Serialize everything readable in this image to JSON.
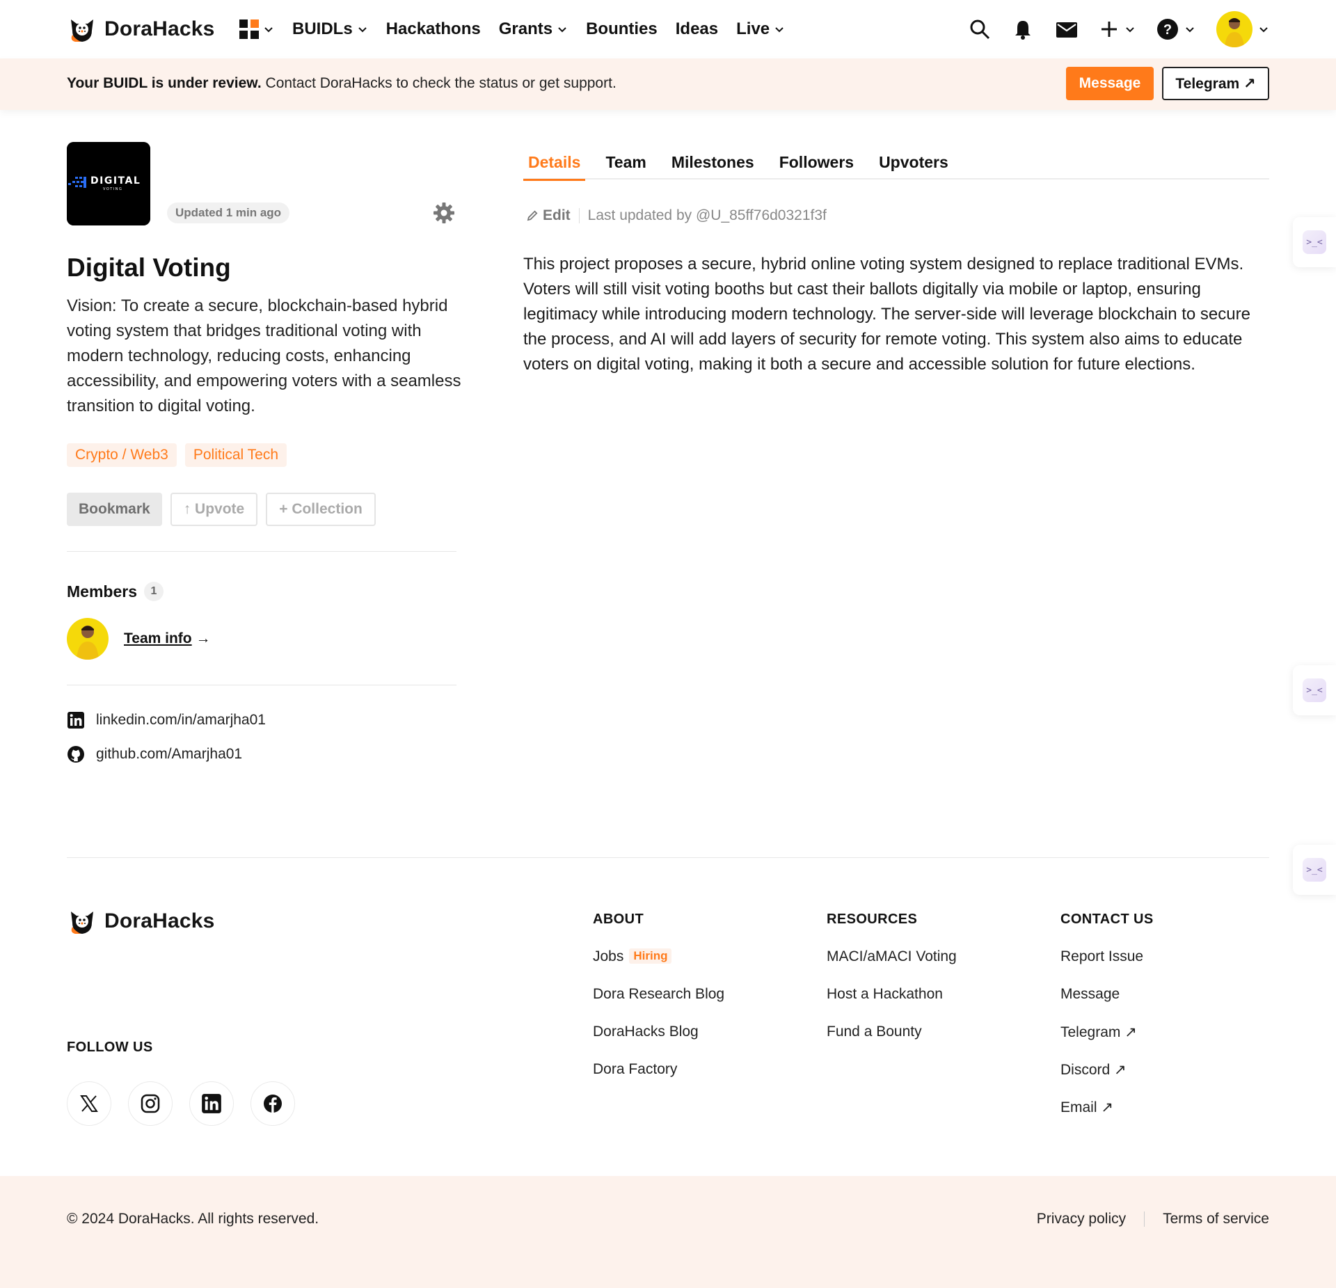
{
  "nav": {
    "brand": "DoraHacks",
    "items": [
      {
        "label": "BUIDLs",
        "dropdown": true
      },
      {
        "label": "Hackathons",
        "dropdown": false
      },
      {
        "label": "Grants",
        "dropdown": true
      },
      {
        "label": "Bounties",
        "dropdown": false
      },
      {
        "label": "Ideas",
        "dropdown": false
      },
      {
        "label": "Live",
        "dropdown": true
      }
    ],
    "icons": [
      "apps-grid-icon",
      "search-icon",
      "bell-icon",
      "mail-icon",
      "plus-icon",
      "help-icon",
      "user-avatar"
    ]
  },
  "banner": {
    "bold": "Your BUIDL is under review.",
    "text": "Contact DoraHacks to check the status or get support.",
    "message_label": "Message",
    "telegram_label": "Telegram ↗"
  },
  "project": {
    "logo_text": "DIGITAL",
    "logo_subtext": "VOTING",
    "updated": "Updated 1 min ago",
    "title": "Digital Voting",
    "vision": "Vision: To create a secure, blockchain-based hybrid voting system that bridges traditional voting with modern technology, reducing costs, enhancing accessibility, and empowering voters with a seamless transition to digital voting.",
    "tags": [
      "Crypto / Web3",
      "Political Tech"
    ],
    "actions": {
      "bookmark": "Bookmark",
      "upvote": "↑ Upvote",
      "collection": "+ Collection"
    },
    "members_label": "Members",
    "members_count": "1",
    "team_info": "Team info",
    "team_arrow": "→",
    "links": [
      {
        "icon": "linkedin-icon",
        "text": "linkedin.com/in/amarjha01"
      },
      {
        "icon": "github-icon",
        "text": "github.com/Amarjha01"
      }
    ]
  },
  "tabs": [
    "Details",
    "Team",
    "Milestones",
    "Followers",
    "Upvoters"
  ],
  "active_tab": "Details",
  "details": {
    "edit_label": "Edit",
    "last_updated": "Last updated by @U_85ff76d0321f3f",
    "body": "This project proposes a secure, hybrid online voting system designed to replace traditional EVMs. Voters will still visit voting booths but cast their ballots digitally via mobile or laptop, ensuring legitimacy while introducing modern technology. The server-side will leverage blockchain to secure the process, and AI will add layers of security for remote voting. This system also aims to educate voters on digital voting, making it both a secure and accessible solution for future elections."
  },
  "footer": {
    "brand": "DoraHacks",
    "follow_us": "FOLLOW US",
    "about": {
      "heading": "ABOUT",
      "links": [
        "Jobs",
        "Dora Research Blog",
        "DoraHacks Blog",
        "Dora Factory"
      ],
      "hiring_badge": "Hiring"
    },
    "resources": {
      "heading": "RESOURCES",
      "links": [
        "MACI/aMACI Voting",
        "Host a Hackathon",
        "Fund a Bounty"
      ]
    },
    "contact": {
      "heading": "CONTACT US",
      "links": [
        "Report Issue",
        "Message",
        "Telegram ↗",
        "Discord ↗",
        "Email ↗"
      ]
    },
    "copyright": "© 2024 DoraHacks. All rights reserved.",
    "privacy": "Privacy policy",
    "terms": "Terms of service"
  },
  "colors": {
    "accent": "#ff7a1a",
    "banner_bg": "#fdf2ec",
    "avatar_bg": "#f5d90a"
  }
}
